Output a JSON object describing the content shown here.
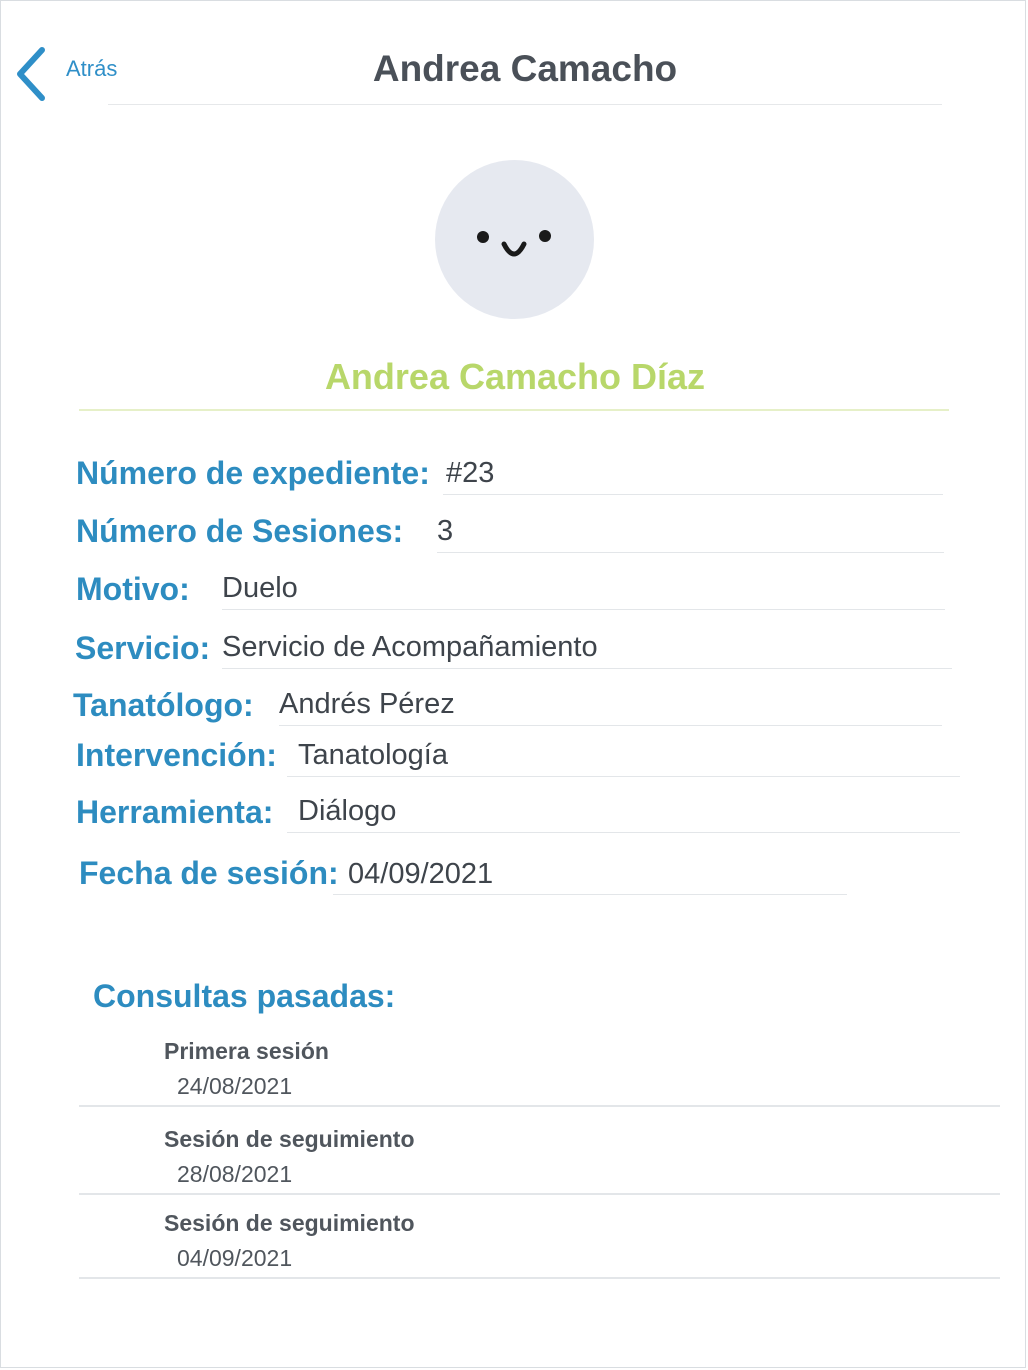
{
  "header": {
    "back_label": "Atrás",
    "title": "Andrea Camacho"
  },
  "profile": {
    "avatar_icon": "smiley-face-icon",
    "full_name": "Andrea Camacho Díaz",
    "name_color": "#b8d76a"
  },
  "fields": {
    "expediente": {
      "label": "Número de expediente:",
      "value": "#23"
    },
    "sesiones": {
      "label": "Número de Sesiones:",
      "value": "3"
    },
    "motivo": {
      "label": "Motivo:",
      "value": "Duelo"
    },
    "servicio": {
      "label": "Servicio:",
      "value": "Servicio de Acompañamiento"
    },
    "tanatologo": {
      "label": "Tanatólogo:",
      "value": "Andrés Pérez"
    },
    "intervencion": {
      "label": "Intervención:",
      "value": "Tanatología"
    },
    "herramienta": {
      "label": "Herramienta:",
      "value": "Diálogo"
    },
    "fecha": {
      "label": "Fecha de sesión:",
      "value": "04/09/2021"
    }
  },
  "past_consults": {
    "title": "Consultas pasadas:",
    "items": [
      {
        "title": "Primera sesión",
        "date": "24/08/2021"
      },
      {
        "title": "Sesión de seguimiento",
        "date": "28/08/2021"
      },
      {
        "title": "Sesión de seguimiento",
        "date": "04/09/2021"
      }
    ]
  },
  "colors": {
    "accent_blue": "#2d8cc0",
    "name_green": "#b8d76a",
    "avatar_bg": "#e6e9f0"
  }
}
